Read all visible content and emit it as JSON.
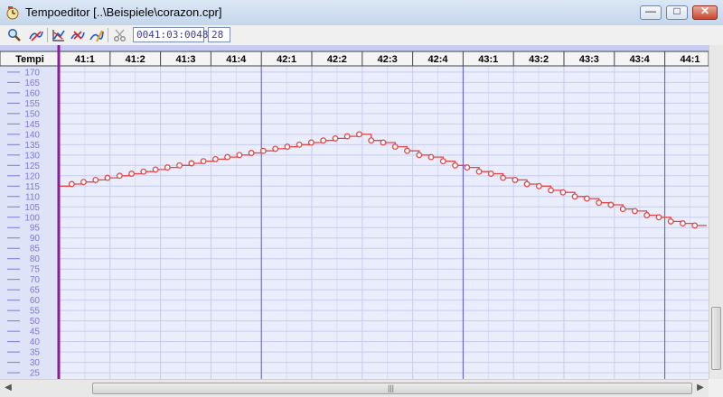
{
  "window": {
    "title": "Tempoeditor [..\\Beispiele\\corazon.cpr]",
    "buttons": {
      "minimize_glyph": "—",
      "maximize_glyph": "□",
      "close_glyph": "✕"
    }
  },
  "toolbar": {
    "tools": [
      {
        "name": "zoom-icon"
      },
      {
        "name": "pencil-curve-icon"
      },
      {
        "name": "line-tool-icon"
      },
      {
        "name": "erase-points-icon"
      },
      {
        "name": "draw-curve-icon"
      },
      {
        "name": "scissors-icon"
      }
    ],
    "position": "0041:03:0048",
    "value": "28"
  },
  "colors": {
    "grid_bg": "#eaedfb",
    "grid_line": "#c7cdf0",
    "bar_line": "#5555dd",
    "cursor": "#8a1f9a",
    "curve": "#e04848",
    "tick_text": "#7a7ad8",
    "header_bg": "#f4f4f4"
  },
  "chart_data": {
    "type": "line",
    "ruler_label": "Tempi",
    "bar_labels": [
      "41:1",
      "41:2",
      "41:3",
      "41:4",
      "42:1",
      "42:2",
      "42:3",
      "42:4",
      "43:1",
      "43:2",
      "43:3",
      "43:4",
      "44:1"
    ],
    "y_ticks": [
      170,
      165,
      160,
      155,
      150,
      145,
      140,
      135,
      130,
      125,
      120,
      115,
      110,
      105,
      100,
      95,
      90,
      85,
      80,
      75,
      70,
      65,
      60,
      55,
      50,
      45,
      40,
      35,
      30,
      25
    ],
    "ylim": [
      22,
      173
    ],
    "grid": true,
    "tempo_values": [
      115,
      116,
      117,
      118,
      119,
      120,
      121,
      122,
      123,
      124,
      125,
      126,
      127,
      128,
      129,
      130,
      131,
      132,
      133,
      134,
      135,
      136,
      137,
      138,
      139,
      140,
      137,
      136,
      134,
      132,
      130,
      129,
      127,
      125,
      124,
      122,
      121,
      119,
      118,
      116,
      115,
      113,
      112,
      110,
      109,
      107,
      106,
      104,
      103,
      101,
      100,
      98,
      97,
      96
    ]
  }
}
